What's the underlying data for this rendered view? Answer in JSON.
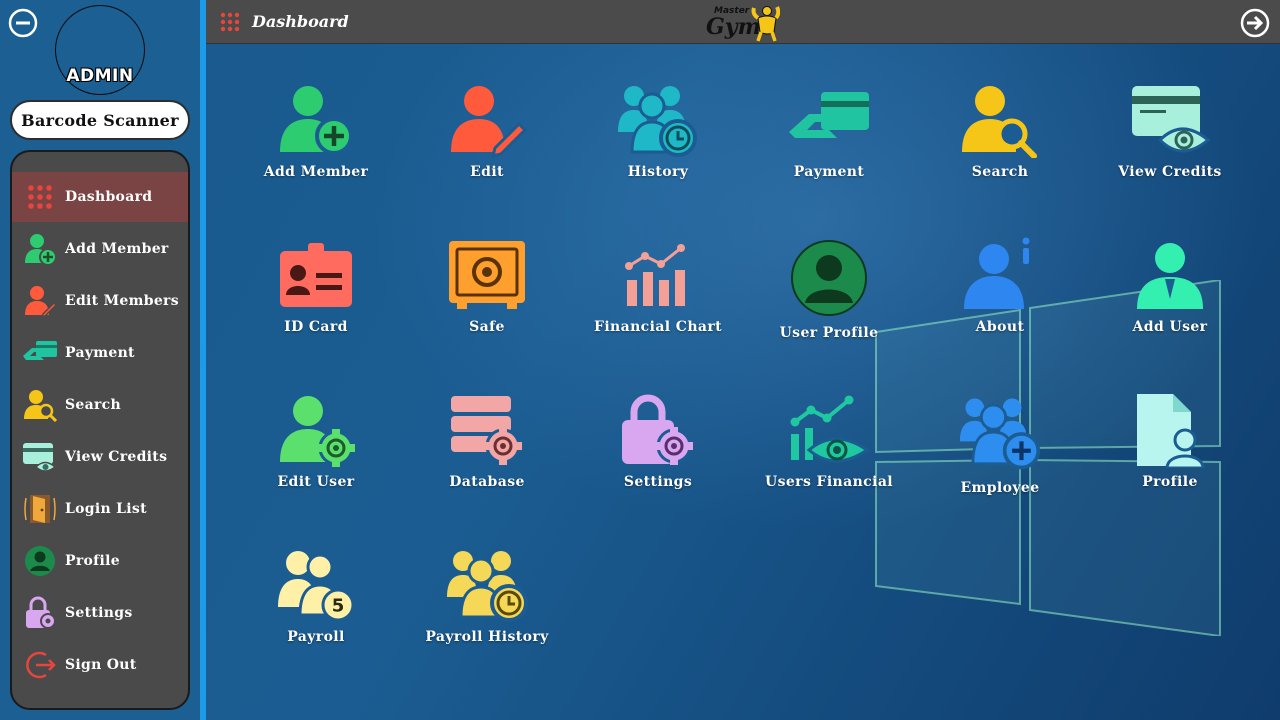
{
  "sidebar": {
    "admin_label": "ADMIN",
    "barcode_button": "Barcode Scanner",
    "items": [
      {
        "label": "Dashboard",
        "icon": "dashboard-grid-icon",
        "active": true
      },
      {
        "label": "Add Member",
        "icon": "add-member-icon"
      },
      {
        "label": "Edit Members",
        "icon": "edit-member-icon"
      },
      {
        "label": "Payment",
        "icon": "payment-icon"
      },
      {
        "label": "Search",
        "icon": "search-user-icon"
      },
      {
        "label": "View Credits",
        "icon": "view-credits-icon"
      },
      {
        "label": "Login List",
        "icon": "door-icon"
      },
      {
        "label": "Profile",
        "icon": "profile-icon"
      },
      {
        "label": "Settings",
        "icon": "settings-lock-icon"
      },
      {
        "label": "Sign Out",
        "icon": "sign-out-icon"
      }
    ]
  },
  "header": {
    "title": "Dashboard",
    "brand_small": "Master",
    "brand_large": "Gym"
  },
  "tiles": [
    {
      "label": "Add Member",
      "icon": "add-member-icon",
      "color": "#2ecc71"
    },
    {
      "label": "Edit",
      "icon": "edit-member-icon",
      "color": "#ff5a3c"
    },
    {
      "label": "History",
      "icon": "history-icon",
      "color": "#1fb8c8"
    },
    {
      "label": "Payment",
      "icon": "payment-icon",
      "color": "#21c4a0"
    },
    {
      "label": "Search",
      "icon": "search-user-icon",
      "color": "#f5c518"
    },
    {
      "label": "View Credits",
      "icon": "view-credits-icon",
      "color": "#a8f0dc"
    },
    {
      "label": "ID Card",
      "icon": "id-card-icon",
      "color": "#ff6b5e"
    },
    {
      "label": "Safe",
      "icon": "safe-icon",
      "color": "#ff9f2e"
    },
    {
      "label": "Financial Chart",
      "icon": "financial-chart-icon",
      "color": "#f4a096"
    },
    {
      "label": "User Profile",
      "icon": "user-profile-icon",
      "color": "#1c8a4a"
    },
    {
      "label": "About",
      "icon": "about-user-icon",
      "color": "#2e86f0"
    },
    {
      "label": "Add User",
      "icon": "add-user-icon",
      "color": "#34f0b0"
    },
    {
      "label": "Edit User",
      "icon": "edit-user-icon",
      "color": "#5be06e"
    },
    {
      "label": "Database",
      "icon": "database-icon",
      "color": "#f2a6a6"
    },
    {
      "label": "Settings",
      "icon": "settings-lock-icon",
      "color": "#d9a6f0"
    },
    {
      "label": "Users Financial",
      "icon": "users-financial-icon",
      "color": "#1fc8a0"
    },
    {
      "label": "Employee",
      "icon": "employee-icon",
      "color": "#2e8ef0"
    },
    {
      "label": "Profile",
      "icon": "profile-document-icon",
      "color": "#b8f5ef"
    },
    {
      "label": "Payroll",
      "icon": "payroll-icon",
      "color": "#fff0a8"
    },
    {
      "label": "Payroll History",
      "icon": "payroll-history-icon",
      "color": "#f5d858"
    }
  ],
  "colors": {
    "sidebar_bg": "#1b5f93",
    "sidebar_accent": "#1e9be8",
    "nav_panel": "#4a4a4a",
    "nav_active": "#7a4444",
    "topbar": "#4b4b4b"
  }
}
